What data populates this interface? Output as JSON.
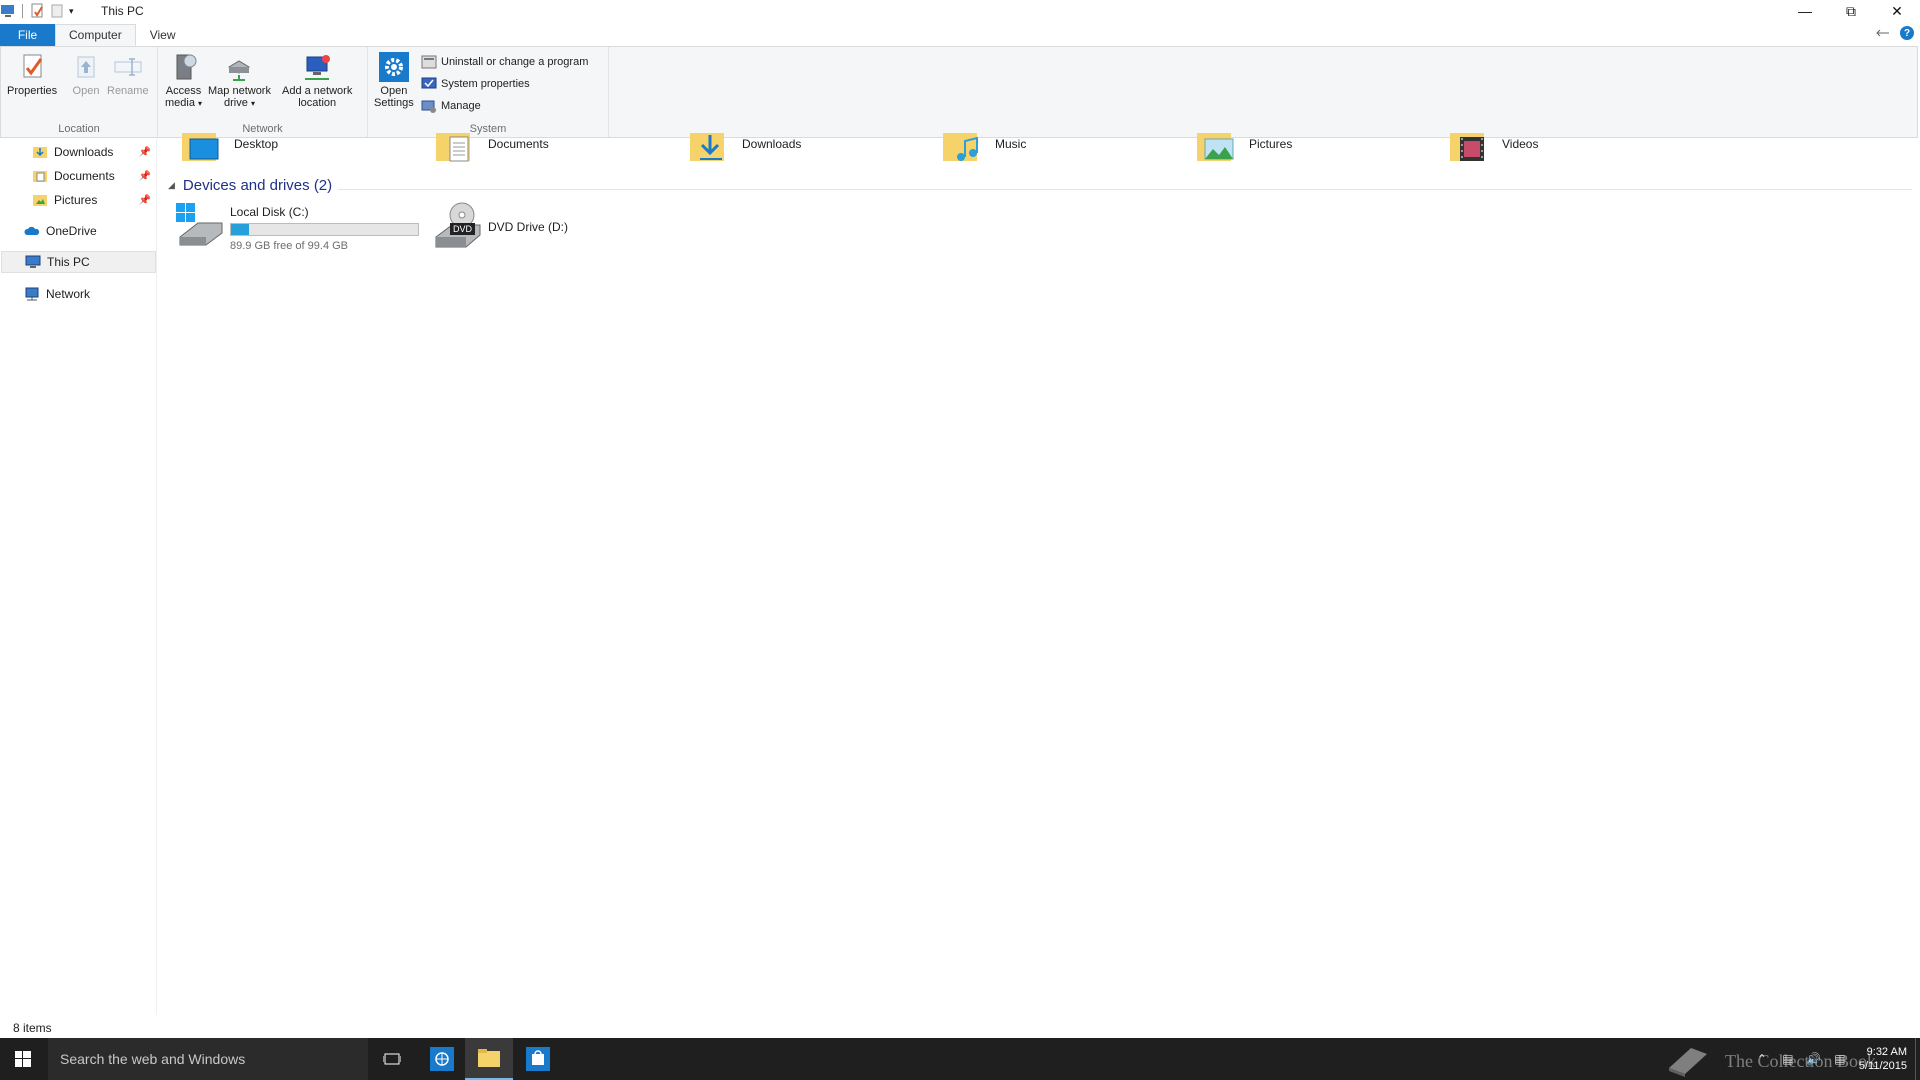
{
  "window": {
    "title": "This PC",
    "controls": [
      "minimize",
      "restore",
      "close"
    ]
  },
  "ribbon": {
    "tabs": [
      {
        "label": "File"
      },
      {
        "label": "Computer"
      },
      {
        "label": "View"
      }
    ],
    "location": {
      "group_label": "Location",
      "properties_label": "Properties",
      "open_label": "Open",
      "rename_label": "Rename"
    },
    "network": {
      "group_label": "Network",
      "access_media_label_1": "Access",
      "access_media_label_2": "media",
      "map_drive_label_1": "Map network",
      "map_drive_label_2": "drive",
      "add_location_label_1": "Add a network",
      "add_location_label_2": "location"
    },
    "system": {
      "group_label": "System",
      "open_settings_label_1": "Open",
      "open_settings_label_2": "Settings",
      "uninstall_label": "Uninstall or change a program",
      "system_properties_label": "System properties",
      "manage_label": "Manage"
    }
  },
  "nav": {
    "items": [
      {
        "label": "Downloads",
        "pinned": true
      },
      {
        "label": "Documents",
        "pinned": true
      },
      {
        "label": "Pictures",
        "pinned": true
      },
      {
        "label": "OneDrive"
      },
      {
        "label": "This PC",
        "selected": true
      },
      {
        "label": "Network"
      }
    ]
  },
  "content": {
    "folders": [
      {
        "label": "Desktop"
      },
      {
        "label": "Documents"
      },
      {
        "label": "Downloads"
      },
      {
        "label": "Music"
      },
      {
        "label": "Pictures"
      },
      {
        "label": "Videos"
      }
    ],
    "devices_header": "Devices and drives (2)",
    "drives": [
      {
        "name": "Local Disk (C:)",
        "free_text": "89.9 GB free of 99.4 GB",
        "used_fraction": 0.096
      },
      {
        "name": "DVD Drive (D:)",
        "badge": "DVD"
      }
    ]
  },
  "status": {
    "items_count": "8 items"
  },
  "taskbar": {
    "search_placeholder": "Search the web and Windows",
    "time": "9:32 AM",
    "date": "5/11/2015",
    "watermark": "The Collection Book"
  },
  "colors": {
    "accent": "#1979ca",
    "section_header": "#1e3287",
    "drive_bar": "#26a0da",
    "taskbar": "#1f1f1f"
  }
}
